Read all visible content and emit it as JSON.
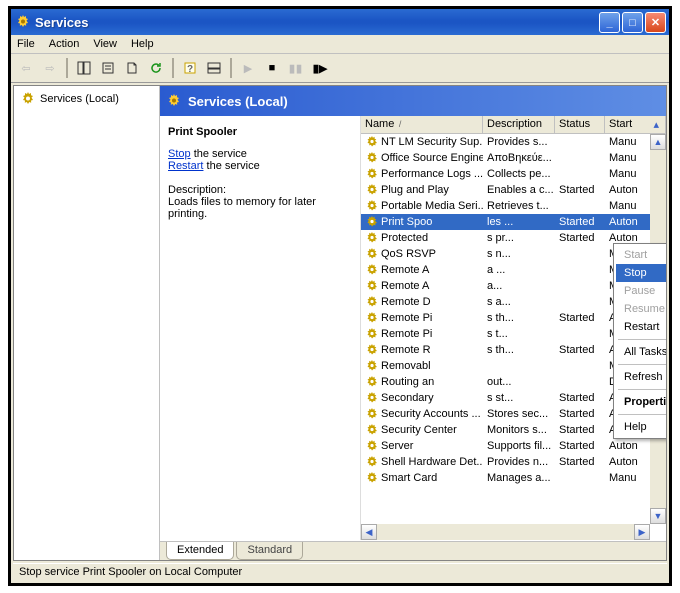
{
  "window": {
    "title": "Services"
  },
  "menu": {
    "file": "File",
    "action": "Action",
    "view": "View",
    "help": "Help"
  },
  "tree": {
    "root": "Services (Local)"
  },
  "banner": {
    "title": "Services (Local)"
  },
  "detail": {
    "title": "Print Spooler",
    "stop_word": "Stop",
    "stop_rest": " the service",
    "restart_word": "Restart",
    "restart_rest": " the service",
    "desc_label": "Description:",
    "desc_text": "Loads files to memory for later printing."
  },
  "columns": {
    "name": "Name",
    "description": "Description",
    "status": "Status",
    "startup": "Start"
  },
  "services": [
    {
      "name": "NT LM Security Sup...",
      "desc": "Provides s...",
      "status": "",
      "start": "Manu"
    },
    {
      "name": "Office Source Engine",
      "desc": "ΑποΒηκεύε...",
      "status": "",
      "start": "Manu"
    },
    {
      "name": "Performance Logs ...",
      "desc": "Collects pe...",
      "status": "",
      "start": "Manu"
    },
    {
      "name": "Plug and Play",
      "desc": "Enables a c...",
      "status": "Started",
      "start": "Auton"
    },
    {
      "name": "Portable Media Seri...",
      "desc": "Retrieves t...",
      "status": "",
      "start": "Manu"
    },
    {
      "name": "Print Spoo",
      "desc": "les ...",
      "status": "Started",
      "start": "Auton",
      "selected": true
    },
    {
      "name": "Protected",
      "desc": "s pr...",
      "status": "Started",
      "start": "Auton"
    },
    {
      "name": "QoS RSVP",
      "desc": "s n...",
      "status": "",
      "start": "Manu"
    },
    {
      "name": "Remote A",
      "desc": "a ...",
      "status": "",
      "start": "Manu"
    },
    {
      "name": "Remote A",
      "desc": "a...",
      "status": "",
      "start": "Manu"
    },
    {
      "name": "Remote D",
      "desc": "s a...",
      "status": "",
      "start": "Manu"
    },
    {
      "name": "Remote Pi",
      "desc": "s th...",
      "status": "Started",
      "start": "Auton"
    },
    {
      "name": "Remote Pi",
      "desc": "s t...",
      "status": "",
      "start": "Manu"
    },
    {
      "name": "Remote R",
      "desc": "s th...",
      "status": "Started",
      "start": "Auton"
    },
    {
      "name": "Removabl",
      "desc": "",
      "status": "",
      "start": "Manu"
    },
    {
      "name": "Routing an",
      "desc": "out...",
      "status": "",
      "start": "Disabl"
    },
    {
      "name": "Secondary",
      "desc": "s st...",
      "status": "Started",
      "start": "Auton"
    },
    {
      "name": "Security Accounts ...",
      "desc": "Stores sec...",
      "status": "Started",
      "start": "Auton"
    },
    {
      "name": "Security Center",
      "desc": "Monitors s...",
      "status": "Started",
      "start": "Auton"
    },
    {
      "name": "Server",
      "desc": "Supports fil...",
      "status": "Started",
      "start": "Auton"
    },
    {
      "name": "Shell Hardware Det...",
      "desc": "Provides n...",
      "status": "Started",
      "start": "Auton"
    },
    {
      "name": "Smart Card",
      "desc": "Manages a...",
      "status": "",
      "start": "Manu"
    }
  ],
  "context_menu": {
    "start": "Start",
    "stop": "Stop",
    "pause": "Pause",
    "resume": "Resume",
    "restart": "Restart",
    "all_tasks": "All Tasks",
    "refresh": "Refresh",
    "properties": "Properties",
    "help": "Help"
  },
  "tabs": {
    "extended": "Extended",
    "standard": "Standard"
  },
  "statusbar": {
    "text": "Stop service Print Spooler on Local Computer"
  }
}
